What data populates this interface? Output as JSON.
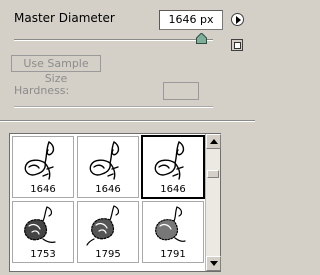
{
  "master_diameter": {
    "label": "Master Diameter",
    "value": "1646 px",
    "slider_fraction": 0.94
  },
  "use_sample_size": {
    "label": "Use Sample Size"
  },
  "hardness": {
    "label": "Hardness:",
    "value": ""
  },
  "brushes": [
    {
      "size": "1646",
      "icon": "rose-outline-brush-icon",
      "selected": false
    },
    {
      "size": "1646",
      "icon": "rose-outline-brush-icon",
      "selected": false
    },
    {
      "size": "1646",
      "icon": "rose-outline-brush-icon",
      "selected": true
    },
    {
      "size": "1753",
      "icon": "rose-filled-brush-icon",
      "selected": false
    },
    {
      "size": "1795",
      "icon": "rose-filled-brush-icon",
      "selected": false
    },
    {
      "size": "1791",
      "icon": "rose-filled-brush-icon",
      "selected": false
    }
  ],
  "icons": {
    "menu_arrow": "panel-menu-arrow-icon",
    "new_preset": "new-preset-icon",
    "scroll_up": "scroll-up-icon",
    "scroll_down": "scroll-down-icon"
  },
  "colors": {
    "panel_bg": "#d4d0c8",
    "disabled_text": "#8c8c8c",
    "thumb_green": "#7fae9a"
  }
}
